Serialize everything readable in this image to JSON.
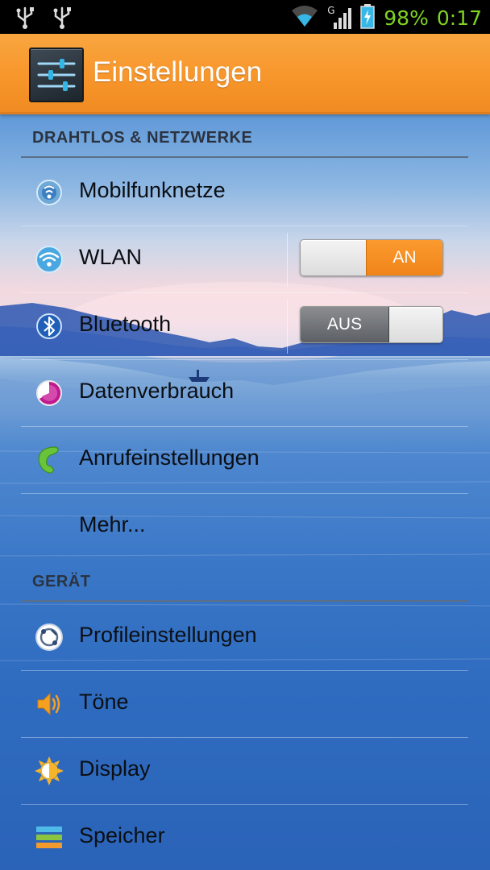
{
  "status_bar": {
    "network_type": "G",
    "battery_percent": "98%",
    "time": "0:17",
    "icons": [
      "usb-icon",
      "usb-icon",
      "wifi-signal-icon",
      "cell-signal-icon",
      "battery-charging-icon"
    ]
  },
  "action_bar": {
    "title": "Einstellungen",
    "icon": "settings-sliders-icon"
  },
  "sections": {
    "wireless": {
      "header": "DRAHTLOS & NETZWERKE",
      "items": [
        {
          "label": "Mobilfunknetze",
          "icon": "mobile-network-icon"
        },
        {
          "label": "WLAN",
          "icon": "wifi-icon",
          "toggle": "AN",
          "state": "on"
        },
        {
          "label": "Bluetooth",
          "icon": "bluetooth-icon",
          "toggle": "AUS",
          "state": "off"
        },
        {
          "label": "Datenverbrauch",
          "icon": "data-usage-icon"
        },
        {
          "label": "Anrufeinstellungen",
          "icon": "phone-icon"
        },
        {
          "label": "Mehr...",
          "icon": ""
        }
      ]
    },
    "device": {
      "header": "GERÄT",
      "items": [
        {
          "label": "Profileinstellungen",
          "icon": "profiles-icon"
        },
        {
          "label": "Töne",
          "icon": "speaker-icon"
        },
        {
          "label": "Display",
          "icon": "brightness-icon"
        },
        {
          "label": "Speicher",
          "icon": "storage-icon"
        }
      ]
    }
  },
  "colors": {
    "action_bar": "#f7962b",
    "status_text": "#80d321",
    "toggle_on": "#f0841a",
    "toggle_off": "#5c5f64"
  }
}
